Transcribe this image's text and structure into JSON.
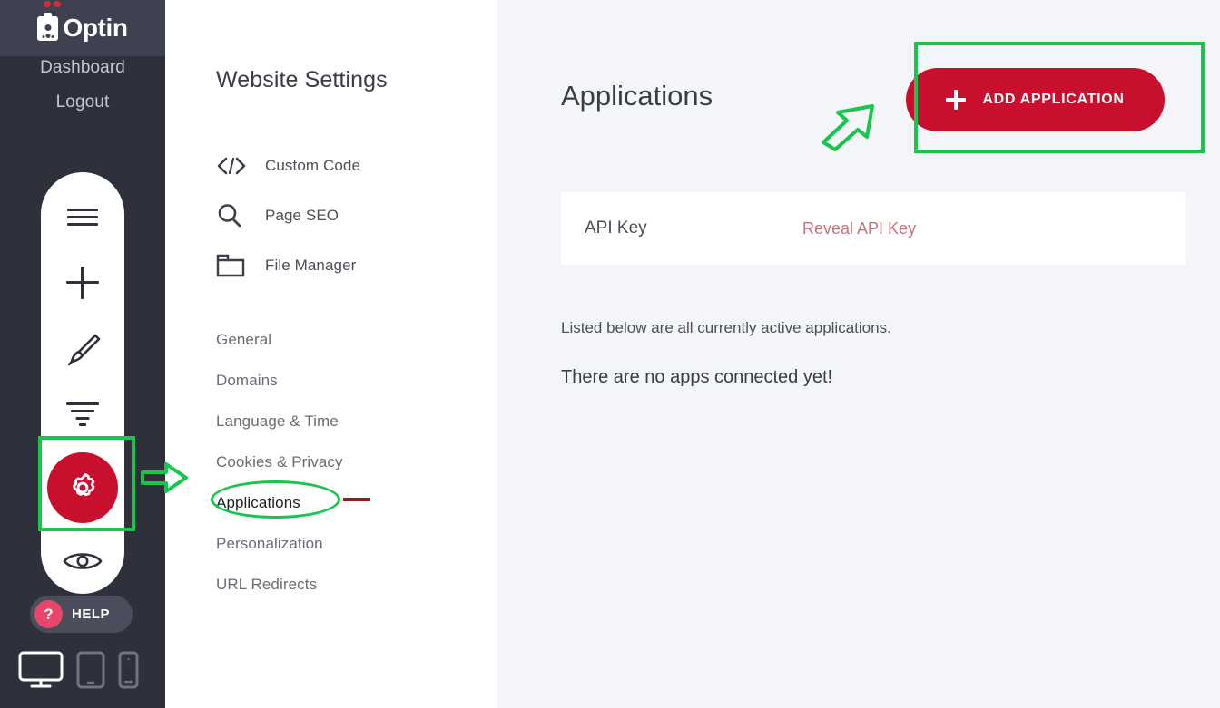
{
  "brand": {
    "logo_text": "Optin",
    "accent_red": "#C8102E",
    "rail_bg": "#2E313C",
    "rail_header_bg": "#3E4250",
    "highlight_green": "#17C64A",
    "help_pink": "#E8476B",
    "reveal_link_color": "#C4737F"
  },
  "rail": {
    "links": [
      {
        "label": "Dashboard",
        "name": "rail-link-dashboard"
      },
      {
        "label": "Logout",
        "name": "rail-link-logout"
      }
    ],
    "tools": [
      {
        "icon": "hamburger-menu-icon",
        "name": "tool-menu-button"
      },
      {
        "icon": "plus-icon",
        "name": "tool-add-button"
      },
      {
        "icon": "paintbrush-icon",
        "name": "tool-design-button"
      },
      {
        "icon": "filter-icon",
        "name": "tool-filter-button"
      },
      {
        "icon": "gear-icon",
        "name": "tool-settings-button",
        "active": true
      },
      {
        "icon": "eye-icon",
        "name": "tool-preview-button"
      }
    ],
    "help": {
      "label": "HELP",
      "icon": "question-mark-icon"
    },
    "devices": [
      {
        "icon": "desktop-icon",
        "name": "device-desktop-button",
        "active": true
      },
      {
        "icon": "tablet-icon",
        "name": "device-tablet-button"
      },
      {
        "icon": "mobile-icon",
        "name": "device-mobile-button"
      }
    ]
  },
  "settings_panel": {
    "title": "Website Settings",
    "tools": [
      {
        "label": "Custom Code",
        "icon": "code-brackets-icon"
      },
      {
        "label": "Page SEO",
        "icon": "magnifier-icon"
      },
      {
        "label": "File Manager",
        "icon": "folder-icon"
      }
    ],
    "nav_items": [
      {
        "label": "General",
        "active": false
      },
      {
        "label": "Domains",
        "active": false
      },
      {
        "label": "Language & Time",
        "active": false
      },
      {
        "label": "Cookies & Privacy",
        "active": false
      },
      {
        "label": "Applications",
        "active": true
      },
      {
        "label": "Personalization",
        "active": false
      },
      {
        "label": "URL Redirects",
        "active": false
      }
    ]
  },
  "main": {
    "title": "Applications",
    "add_button": {
      "label": "ADD APPLICATION",
      "icon": "plus-icon"
    },
    "api_card": {
      "label": "API Key",
      "reveal_label": "Reveal API Key"
    },
    "description": "Listed below are all currently active applications.",
    "empty_state": "There are no apps connected yet!"
  },
  "annotations": [
    {
      "type": "rect",
      "target": "settings-gear-button",
      "color": "#17C64A"
    },
    {
      "type": "arrow",
      "target": "applications-nav-item",
      "color": "#17C64A"
    },
    {
      "type": "ellipse",
      "target": "applications-nav-item",
      "color": "#17C64A"
    },
    {
      "type": "dash",
      "target": "applications-nav-item",
      "color": "#8E1B26"
    },
    {
      "type": "rect",
      "target": "add-application-button",
      "color": "#17C64A"
    },
    {
      "type": "arrow",
      "target": "add-application-button",
      "color": "#17C64A"
    }
  ]
}
